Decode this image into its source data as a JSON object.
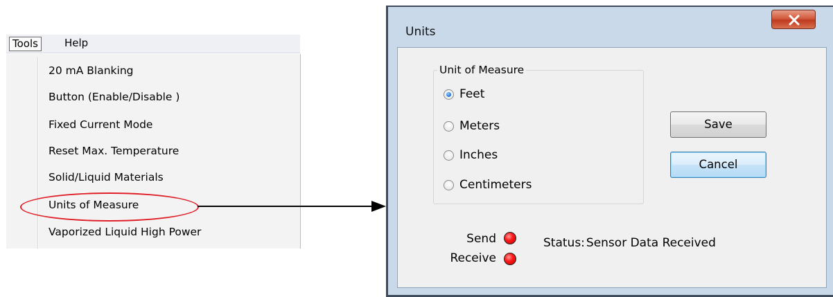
{
  "menu": {
    "top_items": [
      "Tools",
      "Help"
    ],
    "items": [
      "20 mA Blanking",
      "Button (Enable/Disable )",
      "Fixed Current Mode",
      "Reset Max. Temperature",
      "Solid/Liquid Materials",
      "Units of Measure",
      "Vaporized Liquid High Power"
    ],
    "highlighted_item": "Units of Measure",
    "highlight_color": "#e01f28"
  },
  "dialog": {
    "title": "Units",
    "close_glyph": "x",
    "group_title": "Unit of Measure",
    "options": [
      "Feet",
      "Meters",
      "Inches",
      "Centimeters"
    ],
    "selected_option": "Feet",
    "save_label": "Save",
    "cancel_label": "Cancel",
    "indicators": {
      "send_label": "Send",
      "receive_label": "Receive",
      "led_color": "#ff1a1a"
    },
    "status_label": "Status:",
    "status_value": "Sensor Data Received"
  }
}
